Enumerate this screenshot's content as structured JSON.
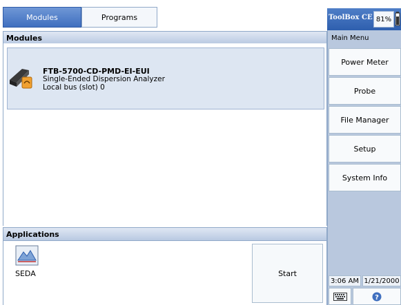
{
  "tabs": [
    {
      "label": "Modules",
      "active": true
    },
    {
      "label": "Programs",
      "active": false
    }
  ],
  "modules_section": {
    "title": "Modules",
    "module": {
      "name": "FTB-5700-CD-PMD-EI-EUI",
      "description": "Single-Ended Dispersion Analyzer",
      "location": "Local bus (slot) 0",
      "icon": "module-card-icon"
    }
  },
  "applications_section": {
    "title": "Applications",
    "apps": [
      {
        "label": "SEDA",
        "icon": "seda-app-icon"
      }
    ],
    "start_label": "Start"
  },
  "right_panel": {
    "brand": "ToolBox CE",
    "battery": "81%",
    "menu_title": "Main Menu",
    "menu_items": [
      "Power Meter",
      "Probe",
      "File Manager",
      "Setup",
      "System Info"
    ],
    "time": "3:06 AM",
    "date": "1/21/2000",
    "bottom_icons": [
      "keyboard-icon",
      "help-icon"
    ]
  },
  "colors": {
    "accent": "#3f6fbf",
    "header_bg": "#c9d6ea",
    "panel_bg": "#b9c8de",
    "module_bg": "#dde6f2"
  }
}
